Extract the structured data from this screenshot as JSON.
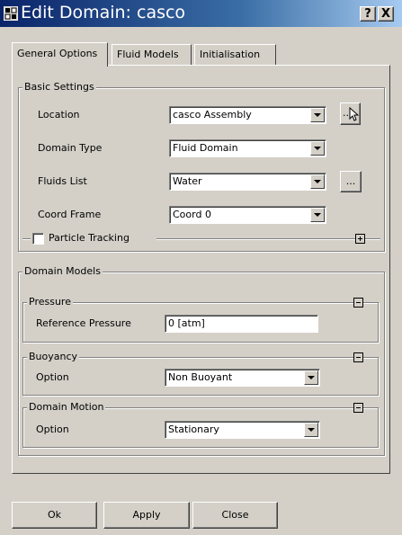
{
  "window": {
    "title": "Edit Domain: casco",
    "help_label": "?",
    "close_label": "X"
  },
  "tabs": [
    {
      "label": "General Options",
      "active": true
    },
    {
      "label": "Fluid Models",
      "active": false
    },
    {
      "label": "Initialisation",
      "active": false
    }
  ],
  "basic_settings": {
    "title": "Basic Settings",
    "location": {
      "label": "Location",
      "value": "casco Assembly",
      "button_label": "..."
    },
    "domain_type": {
      "label": "Domain Type",
      "value": "Fluid Domain"
    },
    "fluids_list": {
      "label": "Fluids List",
      "value": "Water",
      "button_label": "..."
    },
    "coord_frame": {
      "label": "Coord Frame",
      "value": "Coord 0"
    },
    "particle_tracking": {
      "label": "Particle Tracking",
      "checked": false
    }
  },
  "domain_models": {
    "title": "Domain Models",
    "pressure": {
      "title": "Pressure",
      "reference_pressure": {
        "label": "Reference Pressure",
        "value": "0 [atm]"
      }
    },
    "buoyancy": {
      "title": "Buoyancy",
      "option": {
        "label": "Option",
        "value": "Non Buoyant"
      }
    },
    "domain_motion": {
      "title": "Domain Motion",
      "option": {
        "label": "Option",
        "value": "Stationary"
      }
    }
  },
  "footer": {
    "ok_label": "Ok",
    "apply_label": "Apply",
    "close_label": "Close"
  }
}
